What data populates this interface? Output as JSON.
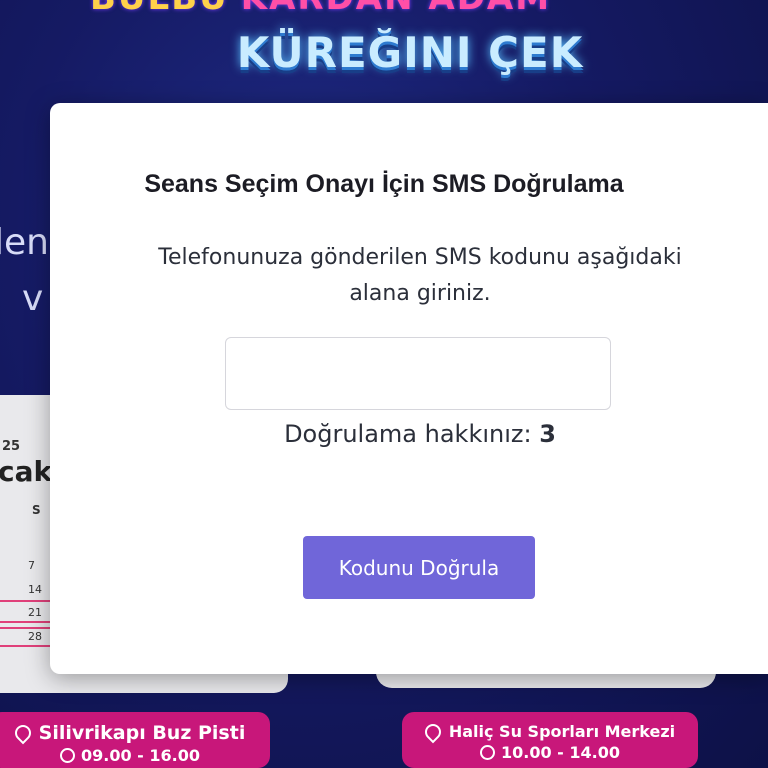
{
  "background": {
    "banner_top_left": "BULBU",
    "banner_top_right": "KARDAN ADAM",
    "banner_main": "KÜREĞINI ÇEK",
    "left_text_1": "len",
    "left_text_2": "v",
    "calendar": {
      "year_fragment": "25",
      "month_fragment": "cak",
      "day_header": "S",
      "days": [
        "7",
        "14",
        "21",
        "28"
      ]
    },
    "venues": [
      {
        "name": "Silivrikapı Buz Pisti",
        "hours": "09.00 - 16.00"
      },
      {
        "name": "Haliç Su Sporları Merkezi",
        "hours": "10.00 - 14.00"
      }
    ]
  },
  "modal": {
    "title": "Seans Seçim Onayı İçin SMS Doğrulama",
    "description": "Telefonunuza gönderilen SMS kodunu aşağıdaki alana giriniz.",
    "code_input": {
      "value": "",
      "placeholder": ""
    },
    "attempts_label": "Doğrulama hakkınız:",
    "attempts_value": "3",
    "verify_button": "Kodunu Doğrula"
  },
  "colors": {
    "accent": "#7066d9",
    "page_bg": "#15195c",
    "venue_pill": "#c8177a"
  },
  "icons": [
    "location-pin-icon",
    "clock-icon"
  ]
}
